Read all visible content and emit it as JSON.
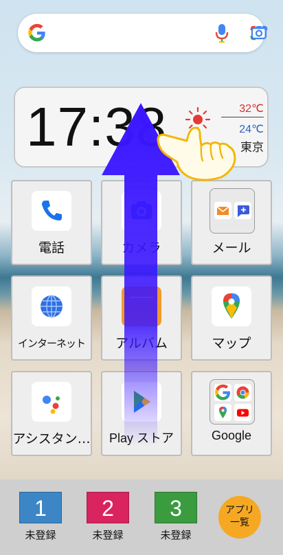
{
  "search": {
    "google_icon": "google-g-icon",
    "mic_icon": "microphone-icon",
    "lens_icon": "google-lens-icon"
  },
  "clock": {
    "time": "17:38",
    "temp_high": "32℃",
    "temp_low": "24℃",
    "city": "東京",
    "weather_icon": "sun-icon"
  },
  "apps": [
    {
      "label": "電話",
      "icon": "phone-icon"
    },
    {
      "label": "カメラ",
      "icon": "camera-icon"
    },
    {
      "label": "メール",
      "icon": "mail-folder-icon"
    },
    {
      "label": "インターネット",
      "icon": "globe-icon"
    },
    {
      "label": "アルバム",
      "icon": "album-icon"
    },
    {
      "label": "マップ",
      "icon": "maps-icon"
    },
    {
      "label": "アシスタン…",
      "icon": "assistant-icon"
    },
    {
      "label": "Play ストア",
      "icon": "play-store-icon"
    },
    {
      "label": "Google",
      "icon": "google-folder-icon"
    }
  ],
  "dock": {
    "contacts": [
      {
        "number": "1",
        "label": "未登録",
        "color": "#3d86c6"
      },
      {
        "number": "2",
        "label": "未登録",
        "color": "#d9245f"
      },
      {
        "number": "3",
        "label": "未登録",
        "color": "#3b9b3f"
      }
    ],
    "apps_button_line1": "アプリ",
    "apps_button_line2": "一覧",
    "apps_button_color": "#f6a823"
  },
  "gesture": {
    "arrow_color": "#3a16ff",
    "hand_icon": "pointing-hand-icon",
    "direction": "swipe-up"
  }
}
